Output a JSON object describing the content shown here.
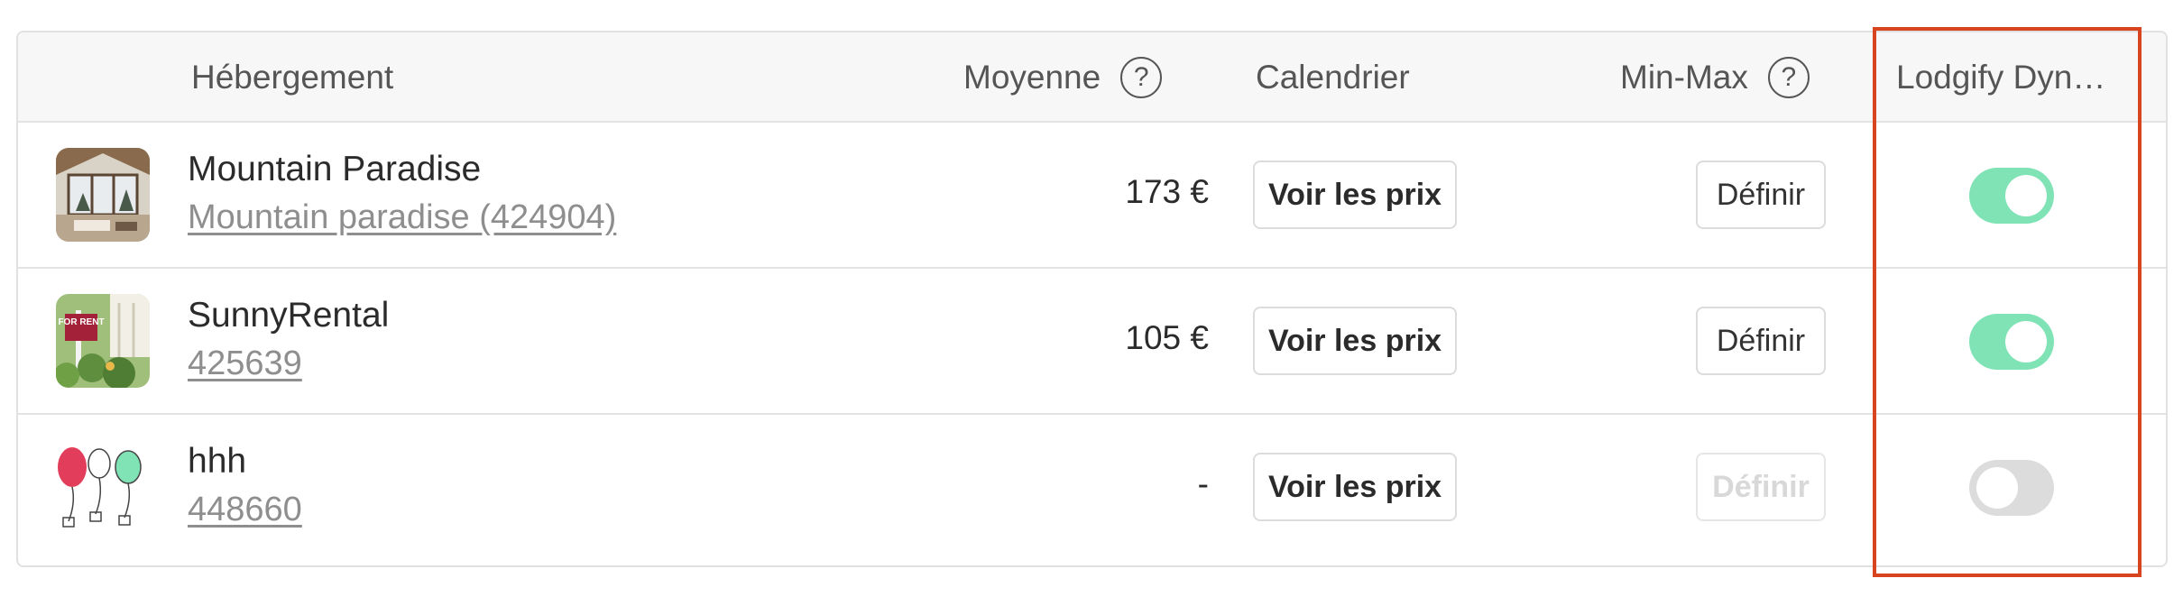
{
  "header": {
    "col_property": "Hébergement",
    "col_average": "Moyenne",
    "col_calendar": "Calendrier",
    "col_minmax": "Min-Max",
    "col_dynamic": "Lodgify Dyn…",
    "help_glyph": "?"
  },
  "rows": [
    {
      "name": "Mountain Paradise",
      "subtitle": "Mountain paradise (424904)",
      "average": "173 €",
      "prices_button": "Voir les prix",
      "define_button": "Définir",
      "define_enabled": true,
      "dynamic_on": true
    },
    {
      "name": "SunnyRental",
      "subtitle": "425639",
      "average": "105 €",
      "prices_button": "Voir les prix",
      "define_button": "Définir",
      "define_enabled": true,
      "dynamic_on": true
    },
    {
      "name": "hhh",
      "subtitle": "448660",
      "average": "-",
      "prices_button": "Voir les prix",
      "define_button": "Définir",
      "define_enabled": false,
      "dynamic_on": false
    }
  ],
  "colors": {
    "toggle_on": "#7fe3b5",
    "toggle_off": "#dcdcdc",
    "highlight": "#d8441f"
  },
  "icons": {
    "row0_thumb": "cabin-photo",
    "row1_thumb": "for-rent-sign-photo",
    "row2_thumb": "balloons-illustration"
  },
  "thumb_sign_text": "FOR RENT"
}
